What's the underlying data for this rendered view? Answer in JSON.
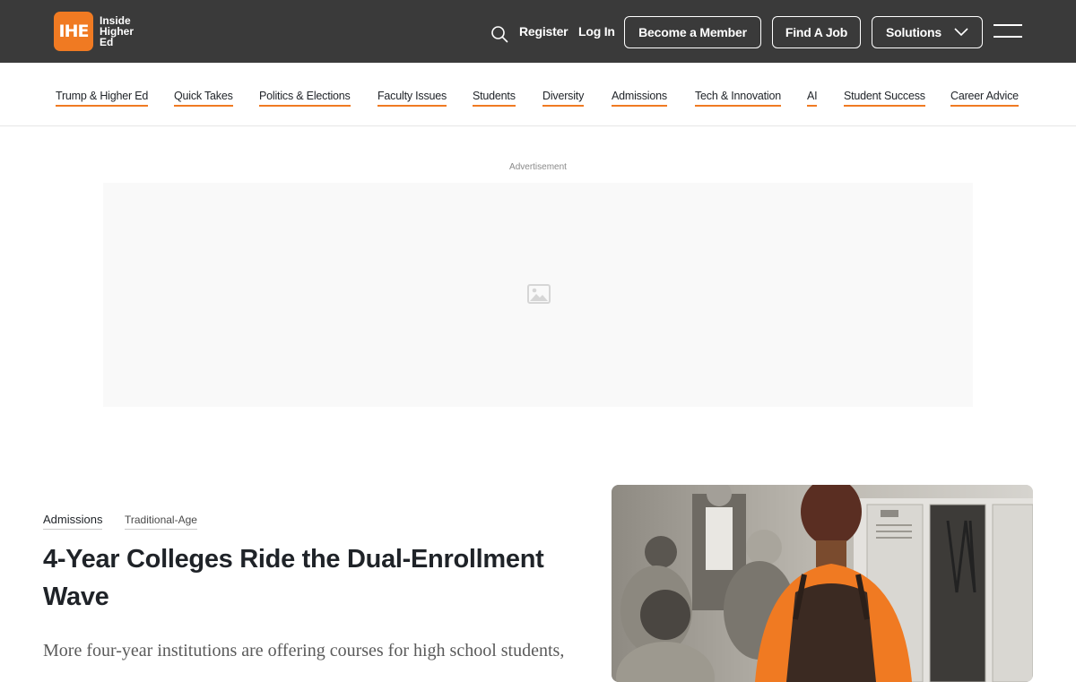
{
  "brand": {
    "logo_mark": "IHE",
    "logo_text": "Inside Higher Ed",
    "accent_color": "#f07a22",
    "header_bg": "#3a3a3a"
  },
  "header": {
    "search_icon": "search-icon",
    "register": "Register",
    "login": "Log In",
    "become_member": "Become a Member",
    "find_job": "Find A Job",
    "solutions": "Solutions",
    "menu_icon": "hamburger-menu-icon"
  },
  "subnav": {
    "items": [
      "Trump & Higher Ed",
      "Quick Takes",
      "Politics & Elections",
      "Faculty Issues",
      "Students",
      "Diversity",
      "Admissions",
      "Tech & Innovation",
      "AI",
      "Student Success",
      "Career Advice"
    ]
  },
  "ad": {
    "label": "Advertisement",
    "placeholder_icon": "image-placeholder-icon"
  },
  "article": {
    "tags": [
      "Admissions",
      "Traditional-Age"
    ],
    "headline": "4-Year Colleges Ride the Dual-Enrollment Wave",
    "dek": "More four-year institutions are offering courses for high school students,"
  }
}
